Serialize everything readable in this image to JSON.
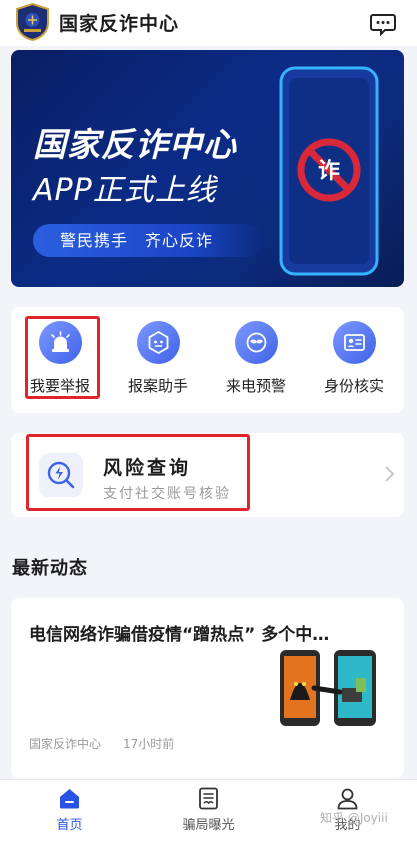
{
  "header": {
    "title": "国家反诈中心",
    "logo_icon": "shield-badge-icon",
    "message_icon": "chat-bubble-icon"
  },
  "banner": {
    "title": "国家反诈中心",
    "subtitle": "APP正式上线",
    "slogan": "警民携手　齐心反诈",
    "phone_icon_text": "诈"
  },
  "quick_actions": [
    {
      "label": "我要举报",
      "icon": "siren-icon"
    },
    {
      "label": "报案助手",
      "icon": "robot-icon"
    },
    {
      "label": "来电预警",
      "icon": "mask-icon"
    },
    {
      "label": "身份核实",
      "icon": "id-card-icon"
    }
  ],
  "risk_query": {
    "title": "风险查询",
    "subtitle": "支付社交账号核验",
    "icon": "magnifier-lightning-icon"
  },
  "latest_news": {
    "section_title": "最新动态",
    "items": [
      {
        "title": "电信网络诈骗借疫情“蹭热点” 多个中…",
        "source": "国家反诈中心",
        "time": "17小时前"
      }
    ]
  },
  "tabbar": {
    "items": [
      {
        "label": "首页",
        "icon": "home-icon",
        "active": true
      },
      {
        "label": "骗局曝光",
        "icon": "document-icon",
        "active": false
      },
      {
        "label": "我的",
        "icon": "user-icon",
        "active": false
      }
    ]
  },
  "watermark": "知乎 @Joyiii",
  "colors": {
    "accent": "#2a53e5",
    "highlight_box": "#e0242b",
    "banner_bg": "#0b2b86"
  }
}
